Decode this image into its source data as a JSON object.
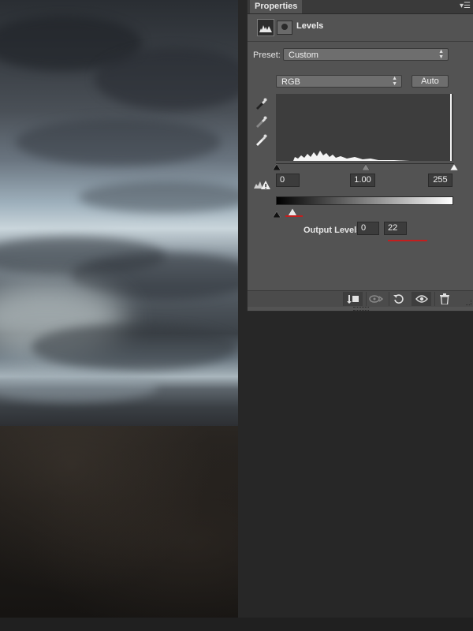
{
  "panel": {
    "tab_label": "Properties",
    "menu_icon": "panel-menu-icon",
    "header": {
      "title": "Levels",
      "icons": [
        "levels-adjustment-icon",
        "layer-mask-icon"
      ]
    },
    "preset": {
      "label": "Preset:",
      "value": "Custom"
    },
    "channel": {
      "value": "RGB"
    },
    "auto_button": "Auto",
    "eyedroppers": [
      "black-point-eyedropper-icon",
      "gray-point-eyedropper-icon",
      "white-point-eyedropper-icon"
    ],
    "input_levels": {
      "black": "0",
      "gamma": "1.00",
      "white": "255"
    },
    "clipping_warning_icon": "clipping-warning-icon",
    "output_levels": {
      "label": "Output Levels:",
      "black": "0",
      "white": "22"
    },
    "footer_icons": [
      "clip-to-layer-icon",
      "view-previous-state-icon",
      "reset-icon",
      "visibility-eye-icon",
      "delete-trash-icon"
    ]
  },
  "colors": {
    "panel_bg": "#535353",
    "highlight_underline": "#c41e1e",
    "workspace_bg": "#272727"
  }
}
